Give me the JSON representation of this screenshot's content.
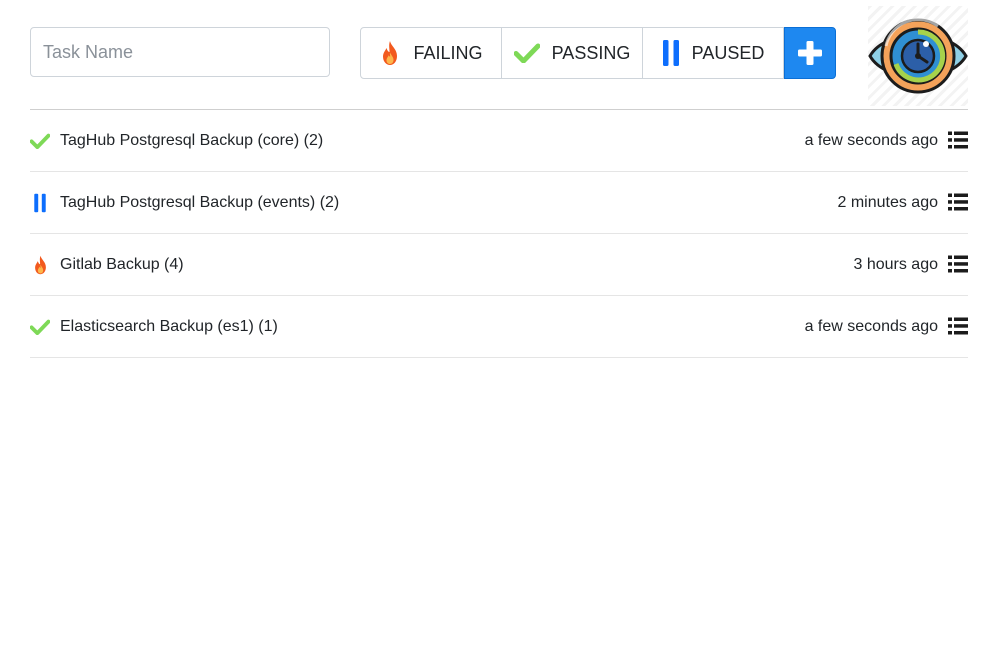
{
  "search": {
    "placeholder": "Task Name",
    "value": ""
  },
  "filters": [
    {
      "label": "FAILING",
      "icon": "fire-icon"
    },
    {
      "label": "PASSING",
      "icon": "check-icon"
    },
    {
      "label": "PAUSED",
      "icon": "pause-icon"
    }
  ],
  "add_button": {
    "icon": "plus-icon"
  },
  "logo": {
    "icon": "eye-clock-logo"
  },
  "tasks": [
    {
      "name": "TagHub Postgresql Backup (core) (2)",
      "status": "passing",
      "time": "a few seconds ago"
    },
    {
      "name": "TagHub Postgresql Backup (events) (2)",
      "status": "paused",
      "time": "2 minutes ago"
    },
    {
      "name": "Gitlab Backup (4)",
      "status": "failing",
      "time": "3 hours ago"
    },
    {
      "name": "Elasticsearch Backup (es1) (1)",
      "status": "passing",
      "time": "a few seconds ago"
    }
  ],
  "colors": {
    "pass": "#7ed957",
    "pause": "#0d6efd",
    "fire": "#f25a1e",
    "add": "#1e88f0"
  }
}
